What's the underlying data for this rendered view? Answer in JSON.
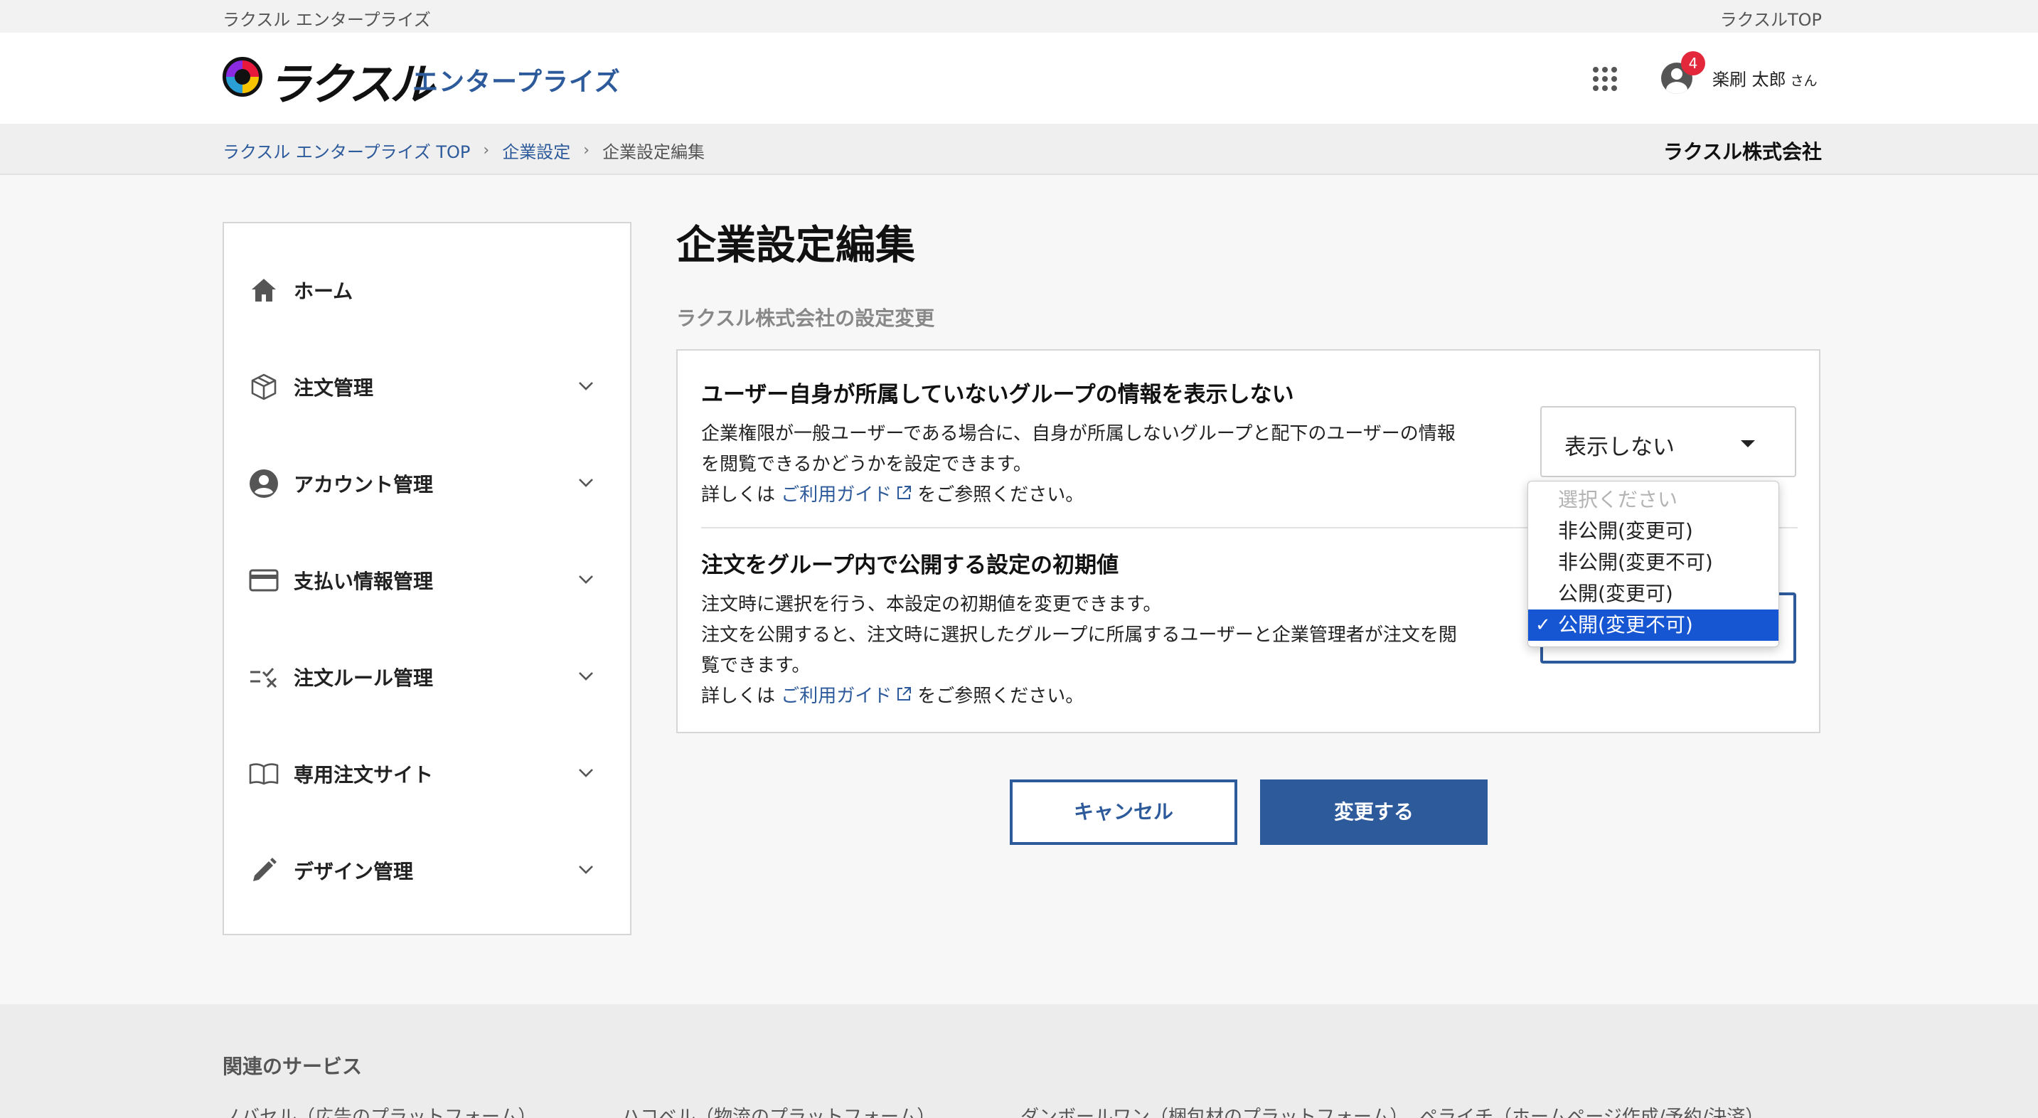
{
  "topbar": {
    "left_text": "ラクスル エンタープライズ",
    "right_link": "ラクスルTOP"
  },
  "header": {
    "logo_text": "ラクスル",
    "logo_sub": "エンタープライズ",
    "notification_count": "4",
    "user_name": "楽刷 太郎",
    "user_suffix": "さん"
  },
  "breadcrumb": {
    "items": [
      "ラクスル エンタープライズ TOP",
      "企業設定",
      "企業設定編集"
    ],
    "company": "ラクスル株式会社"
  },
  "sidebar": {
    "items": [
      {
        "label": "ホーム",
        "icon": "home-icon"
      },
      {
        "label": "注文管理",
        "icon": "box-icon"
      },
      {
        "label": "アカウント管理",
        "icon": "account-icon"
      },
      {
        "label": "支払い情報管理",
        "icon": "credit-card-icon"
      },
      {
        "label": "注文ルール管理",
        "icon": "rule-check-icon"
      },
      {
        "label": "専用注文サイト",
        "icon": "book-icon"
      },
      {
        "label": "デザイン管理",
        "icon": "pencil-icon"
      }
    ]
  },
  "main": {
    "title": "企業設定編集",
    "subtitle": "ラクスル株式会社の設定変更",
    "section1": {
      "title": "ユーザー自身が所属していないグループの情報を表示しない",
      "desc_line1": "企業権限が一般ユーザーである場合に、自身が所属しないグループと配下のユーザーの情報",
      "desc_line2": "を閲覧できるかどうかを設定できます。",
      "guide_prefix": "詳しくは",
      "guide_link": "ご利用ガイド",
      "guide_suffix": "をご参照ください。",
      "select_value": "表示しない"
    },
    "section2": {
      "title": "注文をグループ内で公開する設定の初期値",
      "desc_line1": "注文時に選択を行う、本設定の初期値を変更できます。",
      "desc_line2": "注文を公開すると、注文時に選択したグループに所属するユーザーと企業管理者が注文を閲",
      "desc_line3": "覧できます。",
      "guide_prefix": "詳しくは",
      "guide_link": "ご利用ガイド",
      "guide_suffix": "をご参照ください。",
      "options": [
        "選択ください",
        "非公開(変更可)",
        "非公開(変更不可)",
        "公開(変更可)",
        "公開(変更不可)"
      ],
      "selected_check": "✓"
    },
    "cancel_label": "キャンセル",
    "submit_label": "変更する"
  },
  "footer": {
    "title": "関連のサービス",
    "links": [
      "ノバセル（広告のプラットフォーム）",
      "ハコベル（物流のプラットフォーム）",
      "ダンボールワン（梱包材のプラットフォーム）",
      "ペライチ（ホームページ作成/予約/決済）"
    ]
  },
  "colors": {
    "brand_blue": "#2d5a9b",
    "badge_red": "#e3283b",
    "select_highlight": "#1756d2"
  }
}
